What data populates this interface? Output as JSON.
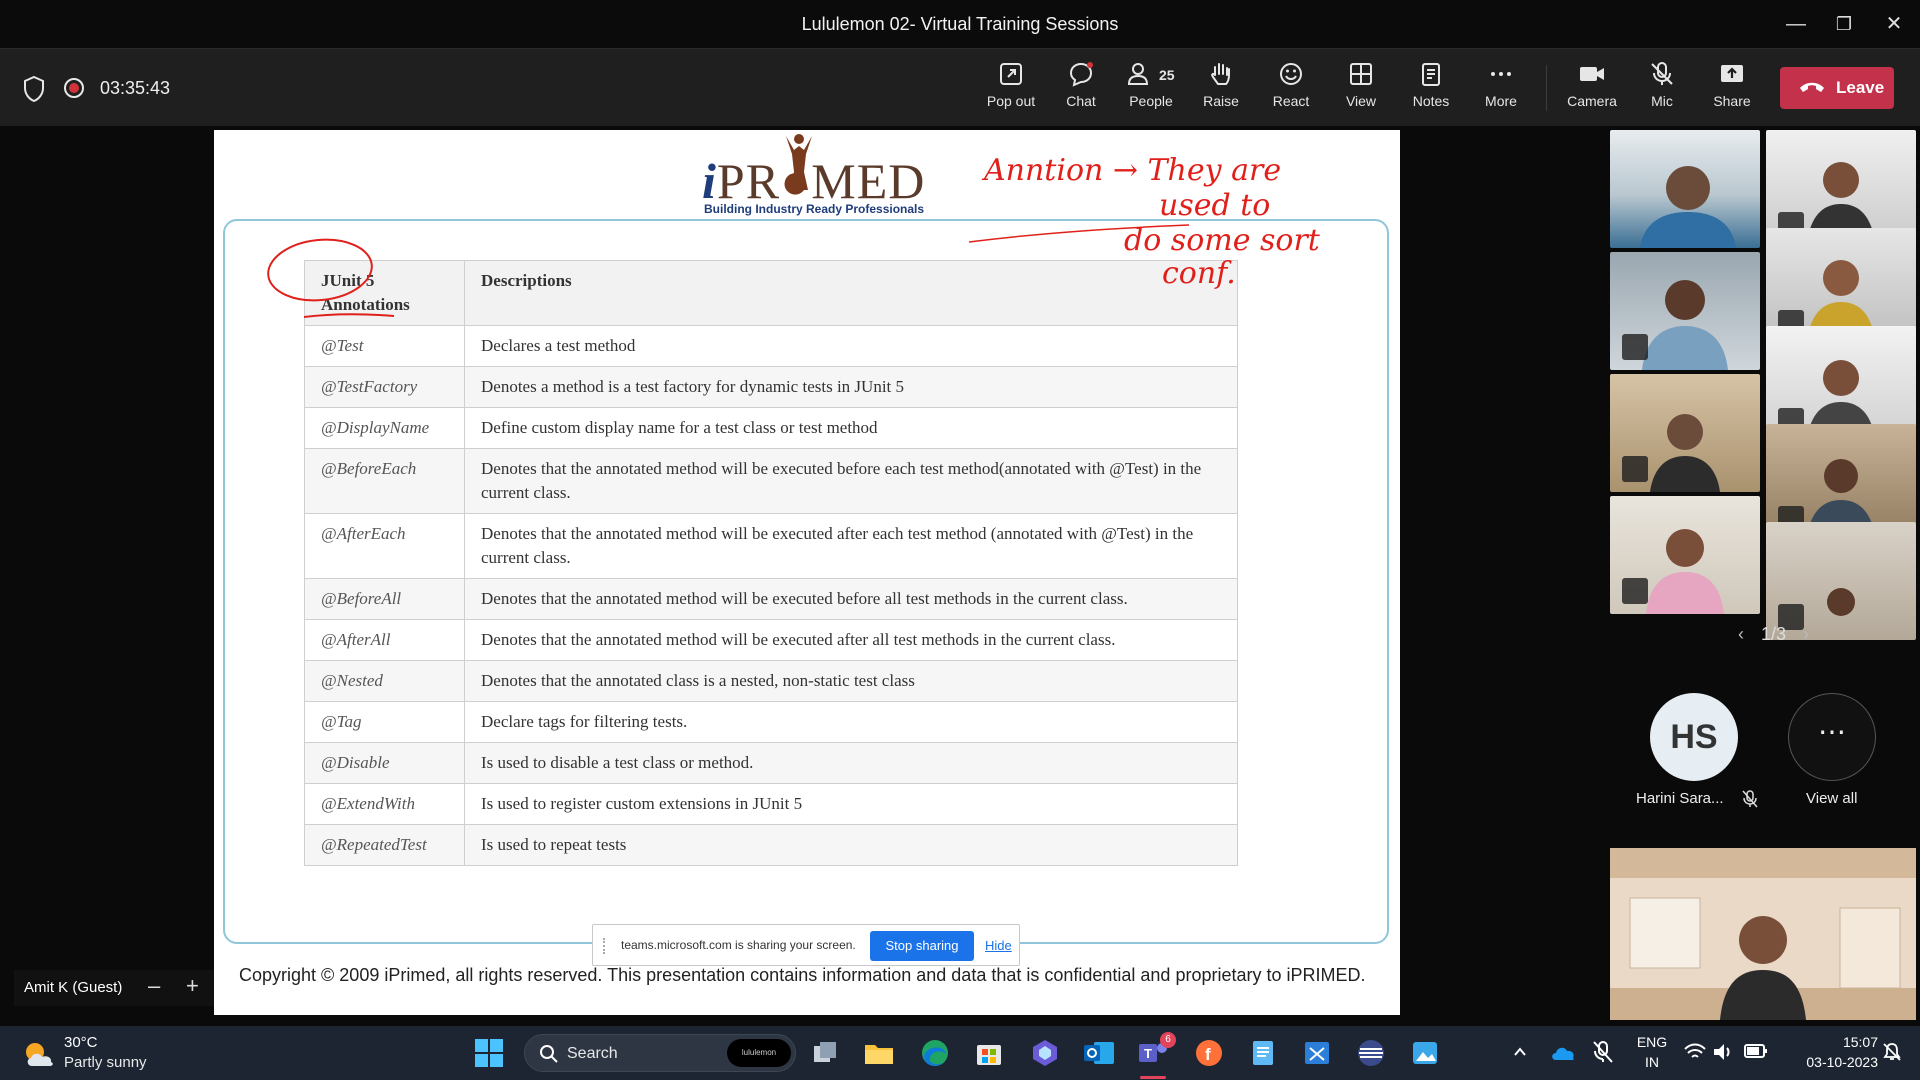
{
  "window": {
    "title": "Lululemon 02- Virtual Training Sessions"
  },
  "toolbar": {
    "timer": "03:35:43",
    "buttons": [
      {
        "label": "Pop out"
      },
      {
        "label": "Chat"
      },
      {
        "label": "People",
        "count": "25"
      },
      {
        "label": "Raise"
      },
      {
        "label": "React"
      },
      {
        "label": "View"
      },
      {
        "label": "Notes"
      },
      {
        "label": "More"
      },
      {
        "label": "Camera"
      },
      {
        "label": "Mic"
      },
      {
        "label": "Share"
      }
    ],
    "leave_label": "Leave"
  },
  "slide": {
    "logo_tagline": "Building Industry Ready Professionals",
    "table_headers": [
      "JUnit 5 Annotations",
      "Descriptions"
    ],
    "rows": [
      {
        "annotation": "@Test",
        "description": "Declares a test method"
      },
      {
        "annotation": "@TestFactory",
        "description": "Denotes a method is a test factory for dynamic tests in JUnit 5"
      },
      {
        "annotation": "@DisplayName",
        "description": "Define custom display name for a test class or test method"
      },
      {
        "annotation": "@BeforeEach",
        "description": "Denotes that the annotated method will be executed before each test method(annotated with @Test) in the current class."
      },
      {
        "annotation": "@AfterEach",
        "description": "Denotes that the annotated method will be executed after each test method (annotated with @Test) in the current class."
      },
      {
        "annotation": "@BeforeAll",
        "description": "Denotes that the annotated method will be executed before all test methods in the current class."
      },
      {
        "annotation": "@AfterAll",
        "description": "Denotes that the annotated method will be executed after all test methods in the current class."
      },
      {
        "annotation": "@Nested",
        "description": "Denotes that the annotated class is a nested, non-static test class"
      },
      {
        "annotation": "@Tag",
        "description": "Declare tags for filtering tests."
      },
      {
        "annotation": "@Disable",
        "description": "Is used to disable a test class or method."
      },
      {
        "annotation": "@ExtendWith",
        "description": "Is used to register custom extensions in JUnit 5"
      },
      {
        "annotation": "@RepeatedTest",
        "description": "Is used to repeat tests"
      }
    ],
    "copyright": "Copyright © 2009 iPrimed, all rights reserved. This presentation contains information and data that is confidential and proprietary to iPRIMED.",
    "handwriting": [
      "Anntion → They are",
      "used to",
      "do some sort",
      "conf."
    ]
  },
  "share_banner": {
    "message": "teams.microsoft.com is sharing your screen.",
    "stop_label": "Stop sharing",
    "hide_label": "Hide"
  },
  "self_view": {
    "name": "Amit K (Guest)"
  },
  "gallery": {
    "pager": "1/3",
    "participant_name": "Harini Sara...",
    "participant_initials": "HS",
    "view_all_label": "View all"
  },
  "taskbar": {
    "temperature": "30°C",
    "weather": "Partly sunny",
    "search_label": "Search",
    "search_pill": "lululemon",
    "teams_badge": "6",
    "lang": "ENG",
    "region": "IN",
    "time": "15:07",
    "date": "03-10-2023"
  },
  "colors": {
    "leave": "#c4314b",
    "stop_sharing": "#1a73e8",
    "ink": "#e0201b",
    "taskbar": "#1c2531"
  }
}
